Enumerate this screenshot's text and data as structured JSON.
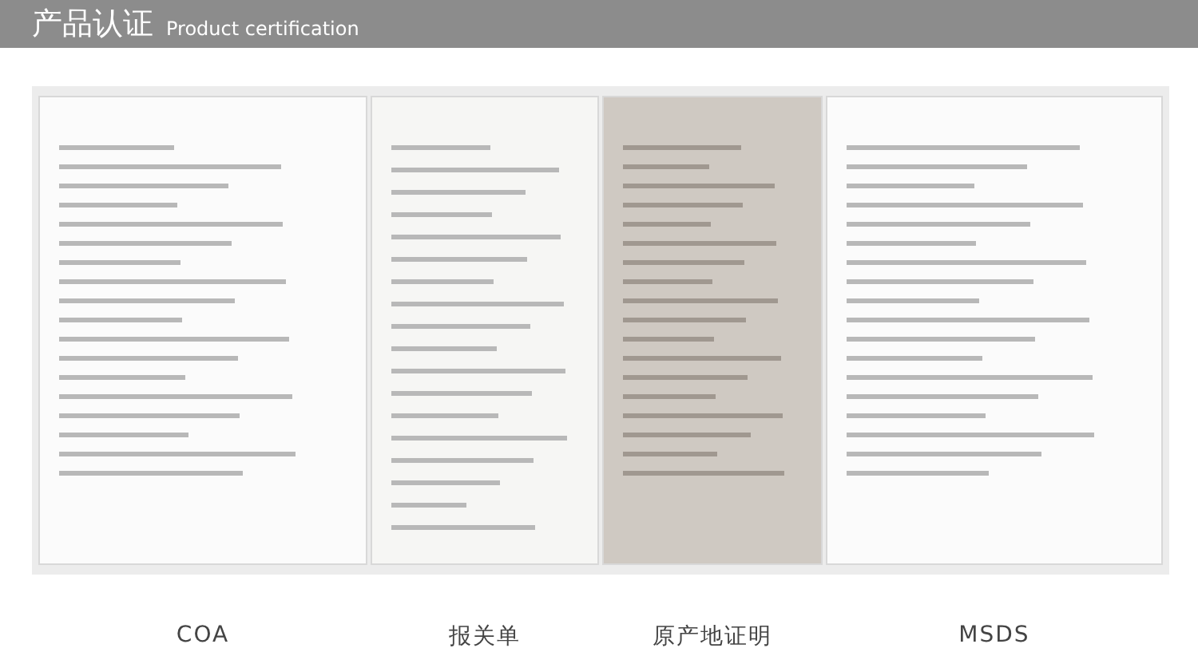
{
  "header": {
    "title": "产品认证",
    "subtitle": "Product certification"
  },
  "certificates": [
    {
      "label": "COA",
      "kind": "plain"
    },
    {
      "label": "报关单",
      "kind": "form"
    },
    {
      "label": "原产地证明",
      "kind": "tinted"
    },
    {
      "label": "MSDS",
      "kind": "plain"
    }
  ]
}
